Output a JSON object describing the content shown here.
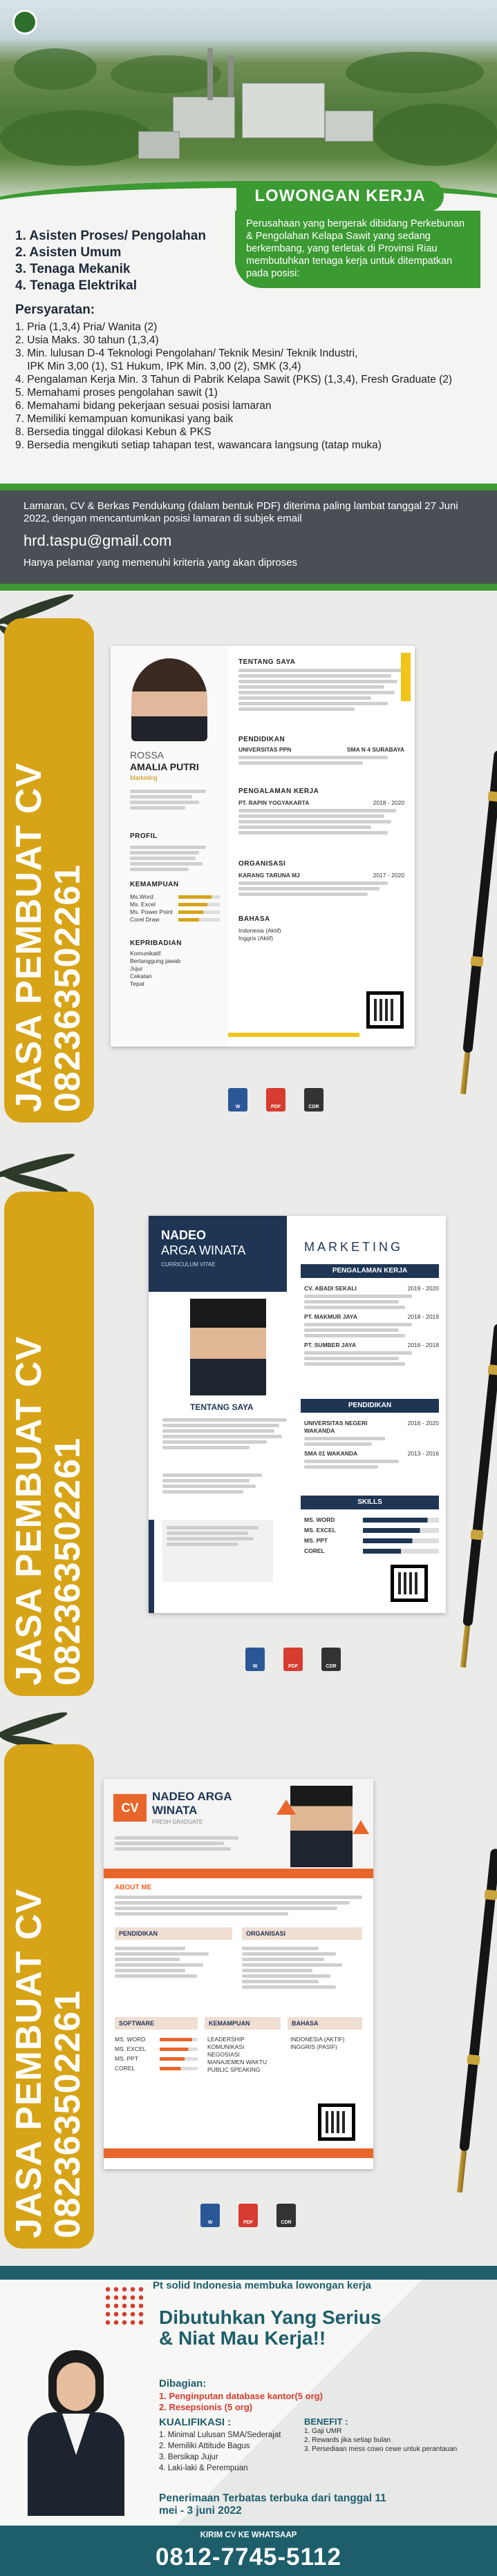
{
  "vacancy": {
    "title": "LOWONGAN KERJA",
    "intro": "Perusahaan yang bergerak dibidang Perkebunan & Pengolahan Kelapa Sawit yang sedang berkembang, yang terletak di Provinsi Riau membutuhkan tenaga kerja untuk ditempatkan pada posisi:",
    "positions": [
      "1. Asisten Proses/ Pengolahan",
      "2. Asisten Umum",
      "3. Tenaga Mekanik",
      "4. Tenaga Elektrikal"
    ],
    "requirements_title": "Persyaratan:",
    "requirements": [
      "1. Pria (1,3,4) Pria/ Wanita (2)",
      "2. Usia Maks. 30 tahun (1,3,4)",
      "3. Min. lulusan D-4 Teknologi Pengolahan/ Teknik Mesin/ Teknik Industri,",
      "    IPK Min 3,00 (1), S1 Hukum, IPK Min. 3,00 (2), SMK (3,4)",
      "4. Pengalaman Kerja Min. 3 Tahun di Pabrik Kelapa Sawit (PKS) (1,3,4), Fresh Graduate (2)",
      "5. Memahami proses pengolahan sawit (1)",
      "6. Memahami bidang pekerjaan sesuai posisi lamaran",
      "7. Memiliki kemampuan komunikasi yang baik",
      "8. Bersedia tinggal dilokasi Kebun & PKS",
      "9. Bersedia mengikuti setiap tahapan test, wawancara langsung (tatap muka)"
    ],
    "apply_text": "Lamaran, CV & Berkas Pendukung (dalam bentuk PDF) diterima paling lambat tanggal 27 Juni 2022, dengan mencantumkan posisi lamaran di subjek email",
    "email": "hrd.taspu@gmail.com",
    "note": "Hanya pelamar yang memenuhi kriteria yang akan diproses"
  },
  "promo_cv": {
    "line1": "JASA PEMBUAT CV",
    "line2": "082363502261"
  },
  "cv1": {
    "first": "ROSSA",
    "last": "AMALIA PUTRI",
    "role": "Marketing",
    "sec_about": "TENTANG SAYA",
    "sec_edu": "PENDIDIKAN",
    "sec_exp": "PENGALAMAN KERJA",
    "sec_org": "ORGANISASI",
    "sec_lang": "BAHASA",
    "sec_profile": "PROFIL",
    "sec_skill": "KEMAMPUAN",
    "sec_personal": "KEPRIBADIAN",
    "edu1": "UNIVERSITAS PPN",
    "edu2": "SMA N 4 SURABAYA",
    "exp1": "PT. RAPIN YOGYAKARTA",
    "exp1_years": "2018 - 2020",
    "org1": "KARANG TARUNA MJ",
    "org1_years": "2017 - 2020",
    "lang1": "Indonesia (Aktif)",
    "lang2": "Inggris (Aktif)",
    "skills": [
      "Ms.Word",
      "Ms. Excel",
      "Ms. Power Point",
      "Corel Draw"
    ],
    "skill_levels": [
      0.8,
      0.7,
      0.6,
      0.5
    ],
    "traits": [
      "Komunikatif",
      "Bertanggung jawab",
      "Jujur",
      "Cekatan",
      "Tepat"
    ]
  },
  "cv2": {
    "first": "NADEO",
    "last": "ARGA WINATA",
    "role": "CURRICULUM VITAE",
    "heading": "MARKETING",
    "sec_exp": "PENGALAMAN KERJA",
    "sec_edu": "PENDIDIKAN",
    "sec_skills": "SKILLS",
    "sec_about": "TENTANG SAYA",
    "exp": [
      "CV. ABADI SEKALI",
      "PT. MAKMUR JAYA",
      "PT. SUMBER JAYA"
    ],
    "exp_years": [
      "2019 - 2020",
      "2018 - 2019",
      "2016 - 2018"
    ],
    "edu": [
      "UNIVERSITAS NEGERI WAKANDA",
      "SMA 01 WAKANDA"
    ],
    "edu_years": [
      "2016 - 2020",
      "2013 - 2016"
    ],
    "skills": [
      "MS. WORD",
      "MS. EXCEL",
      "MS. PPT",
      "COREL"
    ],
    "skill_levels": [
      0.85,
      0.75,
      0.65,
      0.5
    ]
  },
  "cv3": {
    "first": "NADEO ARGA",
    "last": "WINATA",
    "role": "FRESH GRADUATE",
    "badge": "CV",
    "sec_about": "ABOUT ME",
    "sec_edu": "PENDIDIKAN",
    "sec_org": "ORGANISASI",
    "sec_soft": "SOFTWARE",
    "sec_skill": "KEMAMPUAN",
    "sec_lang": "BAHASA",
    "soft": [
      "MS. WORD",
      "MS. EXCEL",
      "MS. PPT",
      "COREL"
    ],
    "soft_levels": [
      0.85,
      0.75,
      0.65,
      0.55
    ],
    "abilities": [
      "LEADERSHIP",
      "KOMUNIKASI",
      "NEGOSIASI",
      "MANAJEMEN WAKTU",
      "PUBLIC SPEAKING"
    ],
    "langs": [
      "INDONESIA (AKTIF)",
      "INGGRIS (PASIF)"
    ]
  },
  "promo": {
    "headline": "Pt solid Indonesia membuka lowongan kerja",
    "big": "Dibutuhkan Yang Serius & Niat Mau Kerja!!",
    "dib_title": "Dibagian:",
    "dib": [
      "1. Penginputan database kantor(5 org)",
      "2. Resepsionis (5 org)"
    ],
    "kual_title": "KUALIFIKASI :",
    "kual": [
      "1. Minimal Lulusan SMA/Sederajat",
      "2. Memiliki Attitude Bagus",
      "3. Bersikap Jujur",
      "4. Laki-laki & Perempuan"
    ],
    "ben_title": "BENEFIT :",
    "ben": [
      "1. Gaji UMR",
      "2. Rewards jika setiap bulan",
      "3. Persediaan mess cowo cewe untuk perantauan"
    ],
    "deadline": "Penerimaan Terbatas terbuka dari tanggal 11 mei - 3 juni 2022",
    "footer_label": "KIRIM CV KE WHATSAAP",
    "phone": "0812-7745-5112"
  },
  "colors": {
    "green": "#3b9a32",
    "gold": "#d7a417",
    "navy": "#1e3554",
    "orange": "#e8662b",
    "teal": "#1e5e6b",
    "red": "#d63c2f"
  }
}
